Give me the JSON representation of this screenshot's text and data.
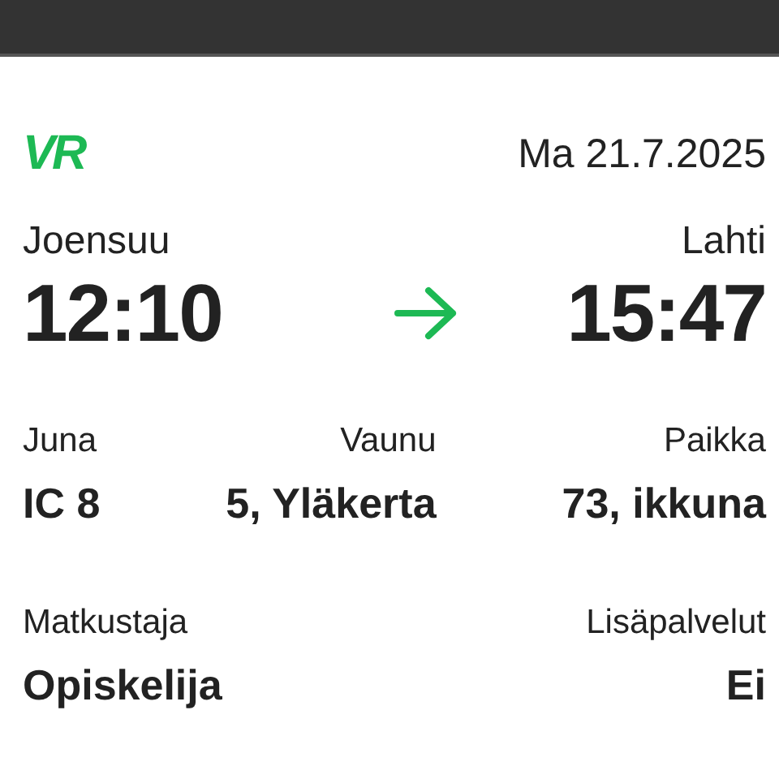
{
  "header": {
    "logo": "VR",
    "date": "Ma 21.7.2025"
  },
  "journey": {
    "from": {
      "station": "Joensuu",
      "time": "12:10"
    },
    "to": {
      "station": "Lahti",
      "time": "15:47"
    }
  },
  "details": [
    [
      {
        "label": "Juna",
        "value": "IC 8"
      },
      {
        "label": "Vaunu",
        "value": "5, Yläkerta"
      },
      {
        "label": "Paikka",
        "value": "73, ikkuna"
      }
    ],
    [
      {
        "label": "Matkustaja",
        "value": "Opiskelija"
      },
      {
        "label": "Lisäpalvelut",
        "value": "Ei"
      }
    ]
  ]
}
